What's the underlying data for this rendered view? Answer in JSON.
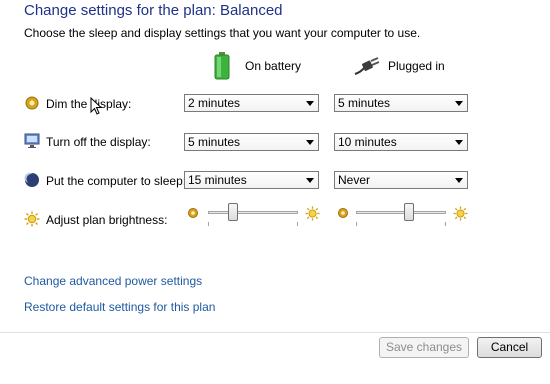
{
  "header": {
    "title": "Change settings for the plan: Balanced",
    "subtitle": "Choose the sleep and display settings that you want your computer to use."
  },
  "columns": {
    "battery_label": "On battery",
    "plugged_label": "Plugged in",
    "battery_icon": "battery-icon",
    "plugged_icon": "power-plug-icon"
  },
  "rows": [
    {
      "label": "Dim the display:",
      "icon": "dim-display-icon",
      "battery_value": "2 minutes",
      "plugged_value": "5 minutes"
    },
    {
      "label": "Turn off the display:",
      "icon": "monitor-icon",
      "battery_value": "5 minutes",
      "plugged_value": "10 minutes"
    },
    {
      "label": "Put the computer to sleep:",
      "icon": "sleep-moon-icon",
      "battery_value": "15 minutes",
      "plugged_value": "Never"
    }
  ],
  "brightness": {
    "label": "Adjust plan brightness:",
    "icon": "sun-icon",
    "battery_level": 0.25,
    "plugged_level": 0.6
  },
  "links": {
    "advanced": "Change advanced power settings",
    "restore": "Restore default settings for this plan"
  },
  "buttons": {
    "save": "Save changes",
    "cancel": "Cancel"
  },
  "colors": {
    "title": "#1e3287",
    "link": "#1e5aa0",
    "battery_green": "#3cb43c"
  }
}
